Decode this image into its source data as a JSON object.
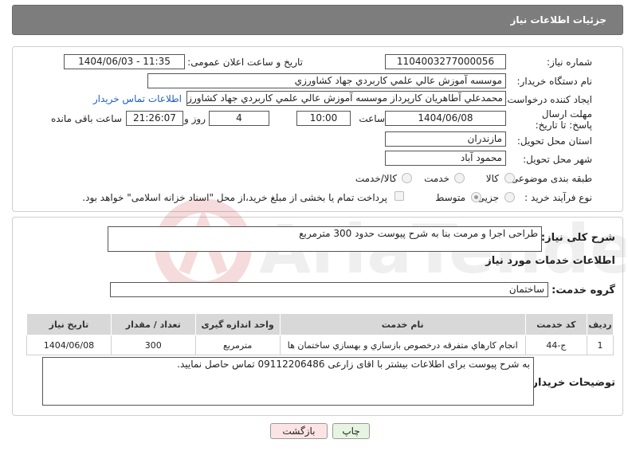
{
  "header": {
    "title": "جزئیات اطلاعات نیاز"
  },
  "form": {
    "need_number_label": "شماره نیاز:",
    "need_number": "1104003277000056",
    "announce_label": "تاریخ و ساعت اعلان عمومی:",
    "announce_value": "1404/06/03 - 11:35",
    "buyer_org_label": "نام دستگاه خریدار:",
    "buyer_org": "موسسه آموزش عالي علمي كاربردي جهاد كشاورزي",
    "requester_label": "ایجاد کننده درخواست:",
    "requester": "محمدعلي آطاهريان كارپرداز موسسه آموزش عالي علمي كاربردي جهاد كشاورزي",
    "contact_link": "اطلاعات تماس خریدار",
    "deadline_label": "مهلت ارسال پاسخ: تا تاریخ:",
    "deadline_date": "1404/06/08",
    "time_label": "ساعت",
    "deadline_time": "10:00",
    "days_value": "4",
    "days_label": "روز و",
    "remaining_time": "21:26:07",
    "remaining_label": "ساعت باقی مانده",
    "province_label": "استان محل تحویل:",
    "province": "مازندران",
    "city_label": "شهر محل تحویل:",
    "city": "محمود آباد",
    "category_label": "طبقه بندی موضوعی:",
    "category_options": [
      "کالا",
      "خدمت",
      "کالا/خدمت"
    ],
    "process_label": "نوع فرآیند خرید :",
    "process_options": [
      "جزیی",
      "متوسط"
    ],
    "payment_note": "پرداخت تمام یا بخشی از مبلغ خرید،از محل \"اسناد خزانه اسلامی\" خواهد بود."
  },
  "summary": {
    "label": "شرح کلی نیاز:",
    "text": "طراحی اجرا و مرمت بنا به شرح پیوست حدود 300 مترمربع"
  },
  "services": {
    "section_title": "اطلاعات خدمات مورد نیاز",
    "group_label": "گروه خدمت:",
    "group_value": "ساختمان",
    "columns": [
      "ردیف",
      "کد خدمت",
      "نام خدمت",
      "واحد اندازه گیری",
      "تعداد / مقدار",
      "تاریخ نیاز"
    ],
    "rows": [
      [
        "1",
        "ج-44",
        "انجام كارهاي متفرقه درخصوص بازسازي و بهسازي ساختمان ها",
        "مترمربع",
        "300",
        "1404/06/08"
      ]
    ]
  },
  "notes": {
    "label": "توضیحات خریدار:",
    "text": "به شرح پیوست برای اطلاعات بیشتر با اقای زارعی 09112206486 تماس حاصل نمایید."
  },
  "buttons": {
    "print": "چاپ",
    "back": "بازگشت"
  },
  "colors": {
    "header_bg": "#7d7d7d",
    "back_btn_bg": "#fde4e4",
    "print_btn_bg": "#e6f5e1",
    "link": "#1f5fbf"
  }
}
